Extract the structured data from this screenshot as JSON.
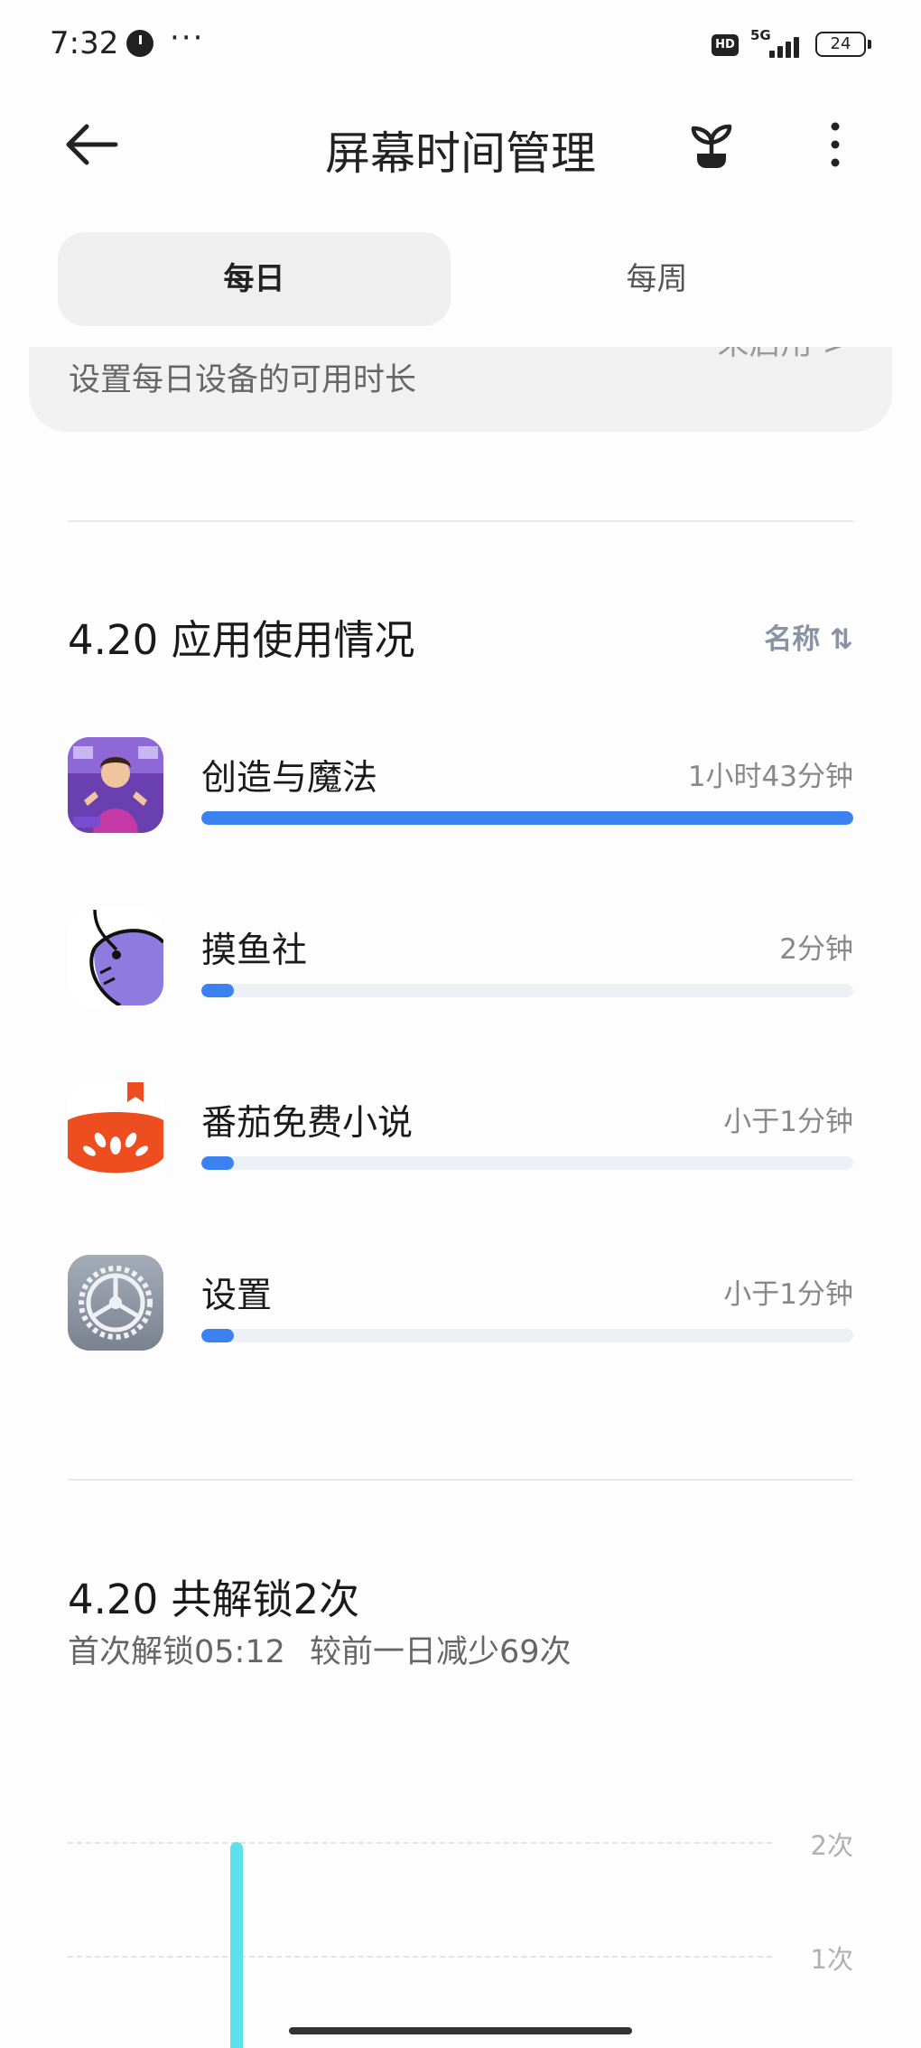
{
  "status_bar": {
    "time": "7:32",
    "dots": "···",
    "hd": "HD",
    "network": "5G",
    "battery": "24"
  },
  "header": {
    "title": "屏幕时间管理"
  },
  "tabs": [
    {
      "label": "每日",
      "active": true
    },
    {
      "label": "每周",
      "active": false
    }
  ],
  "limit_card": {
    "description": "设置每日设备的可用时长",
    "status": "未启用 >"
  },
  "usage": {
    "title": "4.20 应用使用情况",
    "sort_label": "名称 ⇅",
    "apps": [
      {
        "name": "创造与魔法",
        "duration": "1小时43分钟",
        "fraction": 1.0,
        "icon": "creation-magic-app-icon"
      },
      {
        "name": "摸鱼社",
        "duration": "2分钟",
        "fraction": 0.05,
        "icon": "moyushe-app-icon"
      },
      {
        "name": "番茄免费小说",
        "duration": "小于1分钟",
        "fraction": 0.05,
        "icon": "fanqie-novel-app-icon"
      },
      {
        "name": "设置",
        "duration": "小于1分钟",
        "fraction": 0.05,
        "icon": "settings-gear-icon"
      }
    ]
  },
  "unlocks": {
    "title": "4.20 共解锁2次",
    "first_unlock": "首次解锁05:12",
    "comparison": "较前一日减少69次"
  },
  "chart_data": {
    "type": "bar",
    "y_ticks": [
      "2次",
      "1次"
    ],
    "ylim": [
      0,
      2
    ],
    "series": [
      {
        "values": [
          2
        ]
      }
    ],
    "bar_color": "#5ee0ea"
  },
  "colors": {
    "accent_bar": "#3b82f0",
    "track": "#eceff3",
    "unlock_bar": "#5ee0ea"
  }
}
